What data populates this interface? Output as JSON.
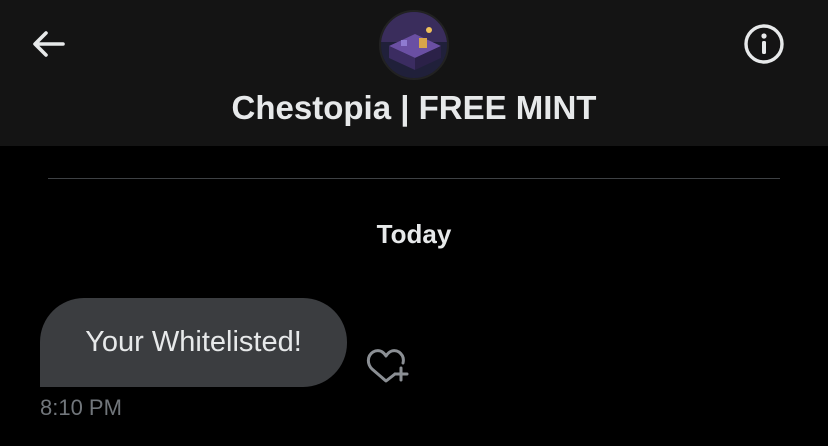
{
  "header": {
    "title": "Chestopia | FREE MINT",
    "back_icon": "arrow-left-icon",
    "info_icon": "info-circle-icon",
    "avatar_alt": ""
  },
  "conversation": {
    "day_label": "Today",
    "messages": [
      {
        "text": "Your Whitelisted!",
        "time": "8:10 PM",
        "direction": "incoming",
        "reaction_icon": "heart-plus-icon"
      }
    ]
  },
  "colors": {
    "background": "#000000",
    "header_bg": "#141414",
    "bubble_bg": "#3b3d40",
    "text": "#e7e9ea",
    "muted_text": "#71767b",
    "divider": "#3e4144"
  }
}
